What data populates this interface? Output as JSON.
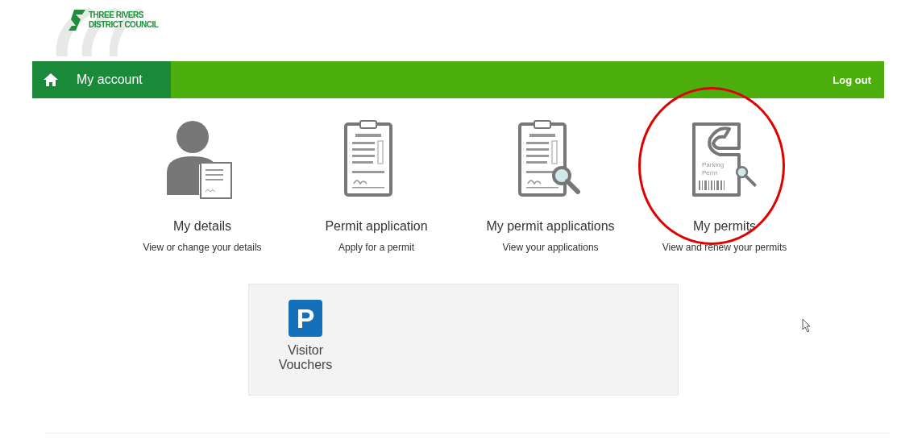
{
  "logo": {
    "line_1": "THREE RIVERS",
    "line_2": "DISTRICT COUNCIL"
  },
  "nav": {
    "home_label": "My account",
    "logout": "Log out"
  },
  "cards": [
    {
      "kind": "person",
      "title": "My details",
      "subtitle": "View or change your details",
      "highlighted": false
    },
    {
      "kind": "clipboard",
      "title": "Permit application",
      "subtitle": "Apply for a permit",
      "highlighted": false
    },
    {
      "kind": "clipboard-search",
      "title": "My permit applications",
      "subtitle": "View your applications",
      "highlighted": false
    },
    {
      "kind": "permit-search",
      "title": "My permits",
      "subtitle": "View and renew your permits",
      "highlighted": true,
      "icon_text": [
        "Parking",
        "Perm"
      ]
    }
  ],
  "tiles": [
    {
      "kind": "parking",
      "glyph": "P",
      "label": "Visitor Vouchers"
    }
  ]
}
